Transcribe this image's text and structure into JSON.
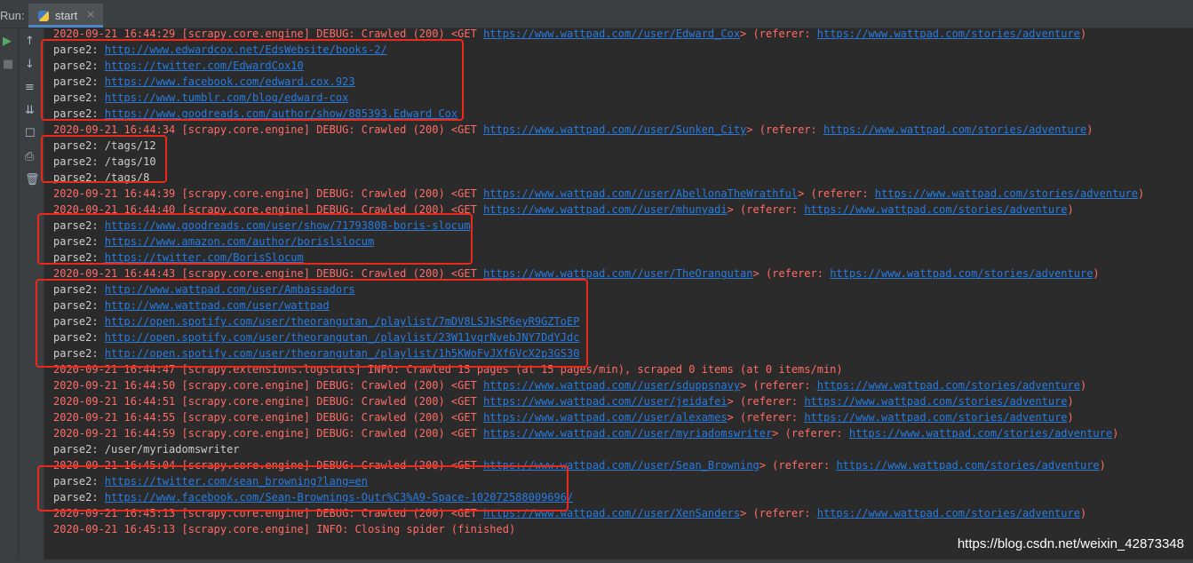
{
  "run_label": "Run:",
  "tab": {
    "label": "start",
    "close": "×"
  },
  "toolbar_left": [
    "▶",
    "■"
  ],
  "toolbar_right": [
    "↑",
    "↓",
    "≡",
    "⇊",
    "☐",
    "⎙",
    "🗑"
  ],
  "lines": [
    {
      "t": "log",
      "parts": [
        {
          "s": "2020-09-21 16:44:29 [scrapy.core.engine] DEBUG: Crawled (200) <GET "
        },
        {
          "s": "https://www.wattpad.com//user/Edward_Cox",
          "link": true
        },
        {
          "s": "> (referer: "
        },
        {
          "s": "https://www.wattpad.com/stories/adventure",
          "link": true
        },
        {
          "s": ")"
        }
      ]
    },
    {
      "t": "out",
      "parts": [
        {
          "s": "parse2: "
        },
        {
          "s": "http://www.edwardcox.net/EdsWebsite/books-2/",
          "link": true
        }
      ]
    },
    {
      "t": "out",
      "parts": [
        {
          "s": "parse2: "
        },
        {
          "s": "https://twitter.com/EdwardCox10",
          "link": true
        }
      ]
    },
    {
      "t": "out",
      "parts": [
        {
          "s": "parse2: "
        },
        {
          "s": "https://www.facebook.com/edward.cox.923",
          "link": true
        }
      ]
    },
    {
      "t": "out",
      "parts": [
        {
          "s": "parse2: "
        },
        {
          "s": "https://www.tumblr.com/blog/edward-cox",
          "link": true
        }
      ]
    },
    {
      "t": "out",
      "parts": [
        {
          "s": "parse2: "
        },
        {
          "s": "https://www.goodreads.com/author/show/885393.Edward_Cox",
          "link": true
        }
      ]
    },
    {
      "t": "log",
      "parts": [
        {
          "s": "2020-09-21 16:44:34 [scrapy.core.engine] DEBUG: Crawled (200) <GET "
        },
        {
          "s": "https://www.wattpad.com//user/Sunken_City",
          "link": true
        },
        {
          "s": "> (referer: "
        },
        {
          "s": "https://www.wattpad.com/stories/adventure",
          "link": true
        },
        {
          "s": ")"
        }
      ]
    },
    {
      "t": "out",
      "parts": [
        {
          "s": "parse2: /tags/12"
        }
      ]
    },
    {
      "t": "out",
      "parts": [
        {
          "s": "parse2: /tags/10"
        }
      ]
    },
    {
      "t": "out",
      "parts": [
        {
          "s": "parse2: /tags/8"
        }
      ]
    },
    {
      "t": "log",
      "parts": [
        {
          "s": "2020-09-21 16:44:39 [scrapy.core.engine] DEBUG: Crawled (200) <GET "
        },
        {
          "s": "https://www.wattpad.com//user/AbellonaTheWrathful",
          "link": true
        },
        {
          "s": "> (referer: "
        },
        {
          "s": "https://www.wattpad.com/stories/adventure",
          "link": true
        },
        {
          "s": ")"
        }
      ]
    },
    {
      "t": "log",
      "parts": [
        {
          "s": "2020-09-21 16:44:40 [scrapy.core.engine] DEBUG: Crawled (200) <GET "
        },
        {
          "s": "https://www.wattpad.com//user/mhunyadi",
          "link": true
        },
        {
          "s": "> (referer: "
        },
        {
          "s": "https://www.wattpad.com/stories/adventure",
          "link": true
        },
        {
          "s": ")"
        }
      ]
    },
    {
      "t": "out",
      "parts": [
        {
          "s": "parse2: "
        },
        {
          "s": "https://www.goodreads.com/user/show/71793808-boris-slocum",
          "link": true
        }
      ]
    },
    {
      "t": "out",
      "parts": [
        {
          "s": "parse2: "
        },
        {
          "s": "https://www.amazon.com/author/borislslocum",
          "link": true
        }
      ]
    },
    {
      "t": "out",
      "parts": [
        {
          "s": "parse2: "
        },
        {
          "s": "https://twitter.com/BorisSlocum",
          "link": true
        }
      ]
    },
    {
      "t": "log",
      "parts": [
        {
          "s": "2020-09-21 16:44:43 [scrapy.core.engine] DEBUG: Crawled (200) <GET "
        },
        {
          "s": "https://www.wattpad.com//user/TheOrangutan",
          "link": true
        },
        {
          "s": "> (referer: "
        },
        {
          "s": "https://www.wattpad.com/stories/adventure",
          "link": true
        },
        {
          "s": ")"
        }
      ]
    },
    {
      "t": "out",
      "parts": [
        {
          "s": "parse2: "
        },
        {
          "s": "http://www.wattpad.com/user/Ambassadors",
          "link": true
        }
      ]
    },
    {
      "t": "out",
      "parts": [
        {
          "s": "parse2: "
        },
        {
          "s": "http://www.wattpad.com/user/wattpad",
          "link": true
        }
      ]
    },
    {
      "t": "out",
      "parts": [
        {
          "s": "parse2: "
        },
        {
          "s": "http://open.spotify.com/user/theorangutan_/playlist/7mDV8LSJkSP6eyR9GZToEP",
          "link": true
        }
      ]
    },
    {
      "t": "out",
      "parts": [
        {
          "s": "parse2: "
        },
        {
          "s": "http://open.spotify.com/user/theorangutan_/playlist/23W11vqrNvebJNY7DdYJdc",
          "link": true
        }
      ]
    },
    {
      "t": "out",
      "parts": [
        {
          "s": "parse2: "
        },
        {
          "s": "http://open.spotify.com/user/theorangutan_/playlist/1h5KWoFvJXf6VcX2p3GS30",
          "link": true
        }
      ]
    },
    {
      "t": "log",
      "parts": [
        {
          "s": "2020-09-21 16:44:47 [scrapy.extensions.logstats] INFO: Crawled 15 pages (at 15 pages/min), scraped 0 items (at 0 items/min)"
        }
      ]
    },
    {
      "t": "log",
      "parts": [
        {
          "s": "2020-09-21 16:44:50 [scrapy.core.engine] DEBUG: Crawled (200) <GET "
        },
        {
          "s": "https://www.wattpad.com//user/sduppsnavy",
          "link": true
        },
        {
          "s": "> (referer: "
        },
        {
          "s": "https://www.wattpad.com/stories/adventure",
          "link": true
        },
        {
          "s": ")"
        }
      ]
    },
    {
      "t": "log",
      "parts": [
        {
          "s": "2020-09-21 16:44:51 [scrapy.core.engine] DEBUG: Crawled (200) <GET "
        },
        {
          "s": "https://www.wattpad.com//user/jeidafei",
          "link": true
        },
        {
          "s": "> (referer: "
        },
        {
          "s": "https://www.wattpad.com/stories/adventure",
          "link": true
        },
        {
          "s": ")"
        }
      ]
    },
    {
      "t": "log",
      "parts": [
        {
          "s": "2020-09-21 16:44:55 [scrapy.core.engine] DEBUG: Crawled (200) <GET "
        },
        {
          "s": "https://www.wattpad.com//user/alexames",
          "link": true
        },
        {
          "s": "> (referer: "
        },
        {
          "s": "https://www.wattpad.com/stories/adventure",
          "link": true
        },
        {
          "s": ")"
        }
      ]
    },
    {
      "t": "log",
      "parts": [
        {
          "s": "2020-09-21 16:44:59 [scrapy.core.engine] DEBUG: Crawled (200) <GET "
        },
        {
          "s": "https://www.wattpad.com//user/myriadomswriter",
          "link": true
        },
        {
          "s": "> (referer: "
        },
        {
          "s": "https://www.wattpad.com/stories/adventure",
          "link": true
        },
        {
          "s": ")"
        }
      ]
    },
    {
      "t": "out",
      "parts": [
        {
          "s": "parse2: /user/myriadomswriter"
        }
      ]
    },
    {
      "t": "log",
      "parts": [
        {
          "s": "2020-09-21 16:45:04 [scrapy.core.engine] DEBUG: Crawled (200) <GET "
        },
        {
          "s": "https://www.wattpad.com//user/Sean_Browning",
          "link": true
        },
        {
          "s": "> (referer: "
        },
        {
          "s": "https://www.wattpad.com/stories/adventure",
          "link": true
        },
        {
          "s": ")"
        }
      ]
    },
    {
      "t": "out",
      "parts": [
        {
          "s": "parse2: "
        },
        {
          "s": "https://twitter.com/sean_browning?lang=en",
          "link": true
        }
      ]
    },
    {
      "t": "out",
      "parts": [
        {
          "s": "parse2: "
        },
        {
          "s": "https://www.facebook.com/Sean-Brownings-Outr%C3%A9-Space-102072588009696/",
          "link": true
        }
      ]
    },
    {
      "t": "log",
      "parts": [
        {
          "s": "2020-09-21 16:45:13 [scrapy.core.engine] DEBUG: Crawled (200) <GET "
        },
        {
          "s": "https://www.wattpad.com//user/XenSanders",
          "link": true
        },
        {
          "s": "> (referer: "
        },
        {
          "s": "https://www.wattpad.com/stories/adventure",
          "link": true
        },
        {
          "s": ")"
        }
      ]
    },
    {
      "t": "log",
      "parts": [
        {
          "s": "2020-09-21 16:45:13 [scrapy.core.engine] INFO: Closing spider (finished)"
        }
      ]
    }
  ],
  "watermark": "https://blog.csdn.net/weixin_42873348",
  "colors": {
    "log": "#ff6b68",
    "output": "#cccccc",
    "link": "#287bde",
    "highlight_box": "#e8291c"
  }
}
